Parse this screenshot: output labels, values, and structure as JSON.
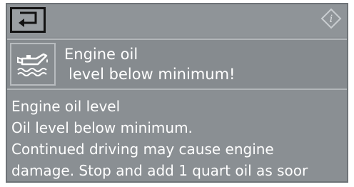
{
  "top_bar": {
    "back_icon": "return-arrow-icon",
    "info_icon": "info-diamond-icon",
    "info_glyph": "i"
  },
  "message": {
    "icon": "engine-oil-can-icon",
    "title_line1": "Engine oil",
    "title_line2": "level below minimum!"
  },
  "detail": {
    "lines": [
      "Engine oil level",
      "Oil level below minimum.",
      "Continued driving may cause engine",
      "damage. Stop and add 1 quart oil as soor"
    ]
  },
  "colors": {
    "screen_bg": "#8a8f93",
    "text": "#ffffff",
    "back_border": "#121212"
  }
}
